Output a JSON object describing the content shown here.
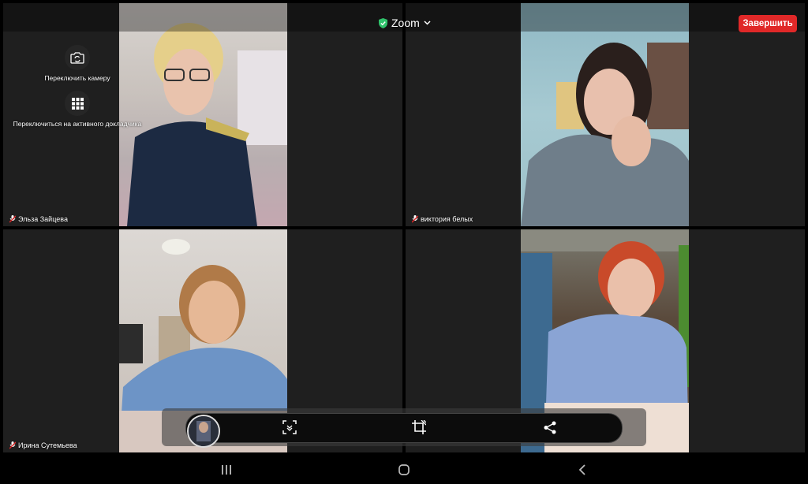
{
  "header": {
    "app_name": "Zoom",
    "end_label": "Завершить"
  },
  "controls": {
    "switch_camera": "Переключить камеру",
    "switch_speaker": "Переключиться на активного докладчика"
  },
  "participants": [
    {
      "name": "Эльза Зайцева"
    },
    {
      "name": "виктория белых"
    },
    {
      "name": "Ирина Сутемьева"
    },
    {
      "name": ""
    }
  ],
  "colors": {
    "end_button": "#e02828",
    "secure_shield": "#2fc26b"
  },
  "icons": {
    "camera_switch": "camera-switch-icon",
    "grid": "grid-icon",
    "screenshot": "screenshot-icon",
    "crop": "crop-icon",
    "share": "share-icon"
  }
}
